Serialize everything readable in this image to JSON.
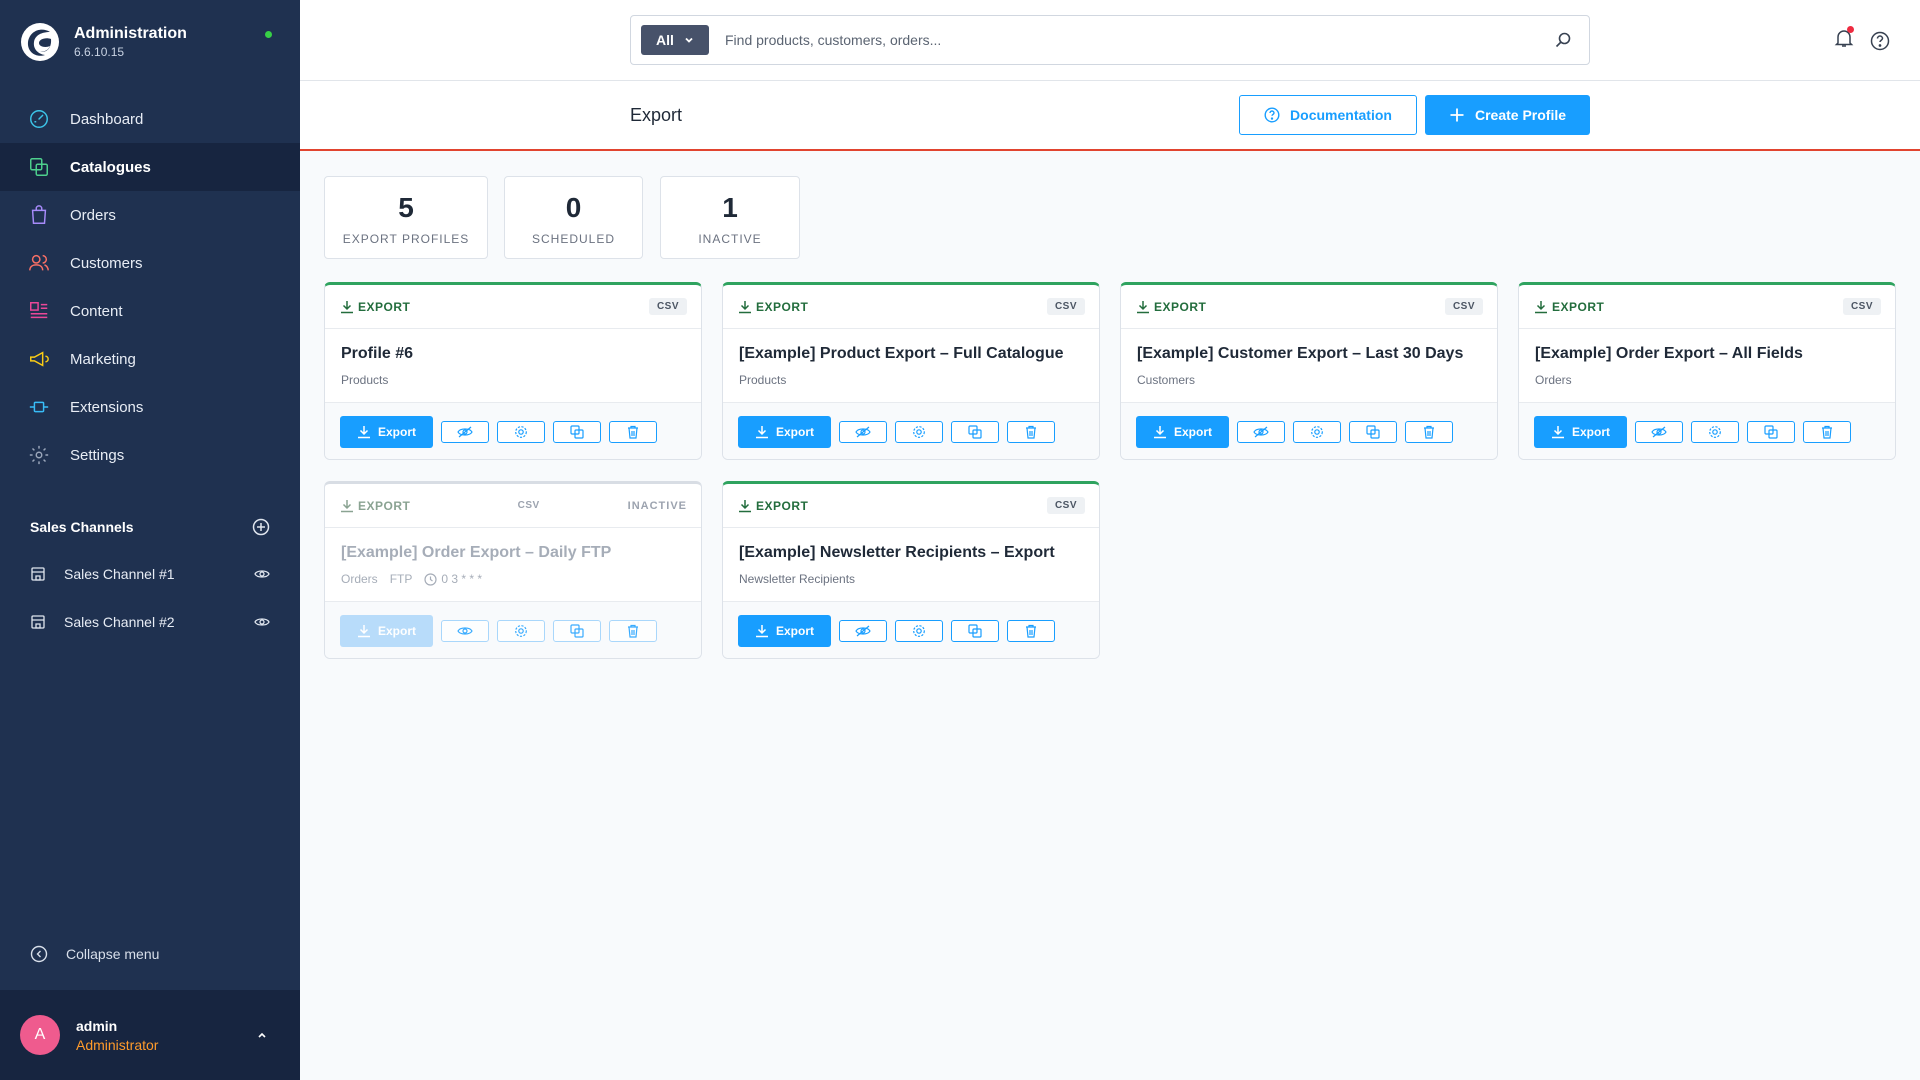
{
  "app": {
    "title": "Administration",
    "version": "6.6.10.15"
  },
  "nav": [
    {
      "label": "Dashboard",
      "icon": "dashboard-icon"
    },
    {
      "label": "Catalogues",
      "icon": "catalogue-icon",
      "active": true
    },
    {
      "label": "Orders",
      "icon": "orders-icon"
    },
    {
      "label": "Customers",
      "icon": "customers-icon"
    },
    {
      "label": "Content",
      "icon": "content-icon"
    },
    {
      "label": "Marketing",
      "icon": "marketing-icon"
    },
    {
      "label": "Extensions",
      "icon": "extensions-icon"
    },
    {
      "label": "Settings",
      "icon": "settings-icon"
    }
  ],
  "sales_channels": {
    "title": "Sales Channels",
    "items": [
      {
        "label": "Sales Channel #1"
      },
      {
        "label": "Sales Channel #2"
      }
    ]
  },
  "collapse_label": "Collapse menu",
  "user": {
    "initial": "A",
    "name": "admin",
    "role": "Administrator"
  },
  "search": {
    "scope": "All",
    "placeholder": "Find products, customers, orders..."
  },
  "page": {
    "title": "Export",
    "documentation_label": "Documentation",
    "create_label": "Create Profile"
  },
  "stats": [
    {
      "value": "5",
      "label": "EXPORT PROFILES"
    },
    {
      "value": "0",
      "label": "SCHEDULED"
    },
    {
      "value": "1",
      "label": "INACTIVE"
    }
  ],
  "cards": [
    {
      "type": "EXPORT",
      "format": "CSV",
      "title": "Profile #6",
      "entity": "Products",
      "export_label": "Export",
      "inactive": false
    },
    {
      "type": "EXPORT",
      "format": "CSV",
      "title": "[Example] Product Export – Full Catalogue",
      "entity": "Products",
      "export_label": "Export",
      "inactive": false
    },
    {
      "type": "EXPORT",
      "format": "CSV",
      "title": "[Example] Customer Export – Last 30 Days",
      "entity": "Customers",
      "export_label": "Export",
      "inactive": false
    },
    {
      "type": "EXPORT",
      "format": "CSV",
      "title": "[Example] Order Export – All Fields",
      "entity": "Orders",
      "export_label": "Export",
      "inactive": false
    },
    {
      "type": "EXPORT",
      "format": "CSV",
      "status": "INACTIVE",
      "title": "[Example] Order Export – Daily FTP",
      "entity": "Orders",
      "transport": "FTP",
      "schedule": "0 3 * * *",
      "export_label": "Export",
      "inactive": true
    },
    {
      "type": "EXPORT",
      "format": "CSV",
      "title": "[Example] Newsletter Recipients – Export",
      "entity": "Newsletter Recipients",
      "export_label": "Export",
      "inactive": false
    }
  ],
  "colors": {
    "sidebar": "#1f3150",
    "accent": "#189eff",
    "export_green": "#236d3d",
    "header_rule": "#e1442f"
  }
}
